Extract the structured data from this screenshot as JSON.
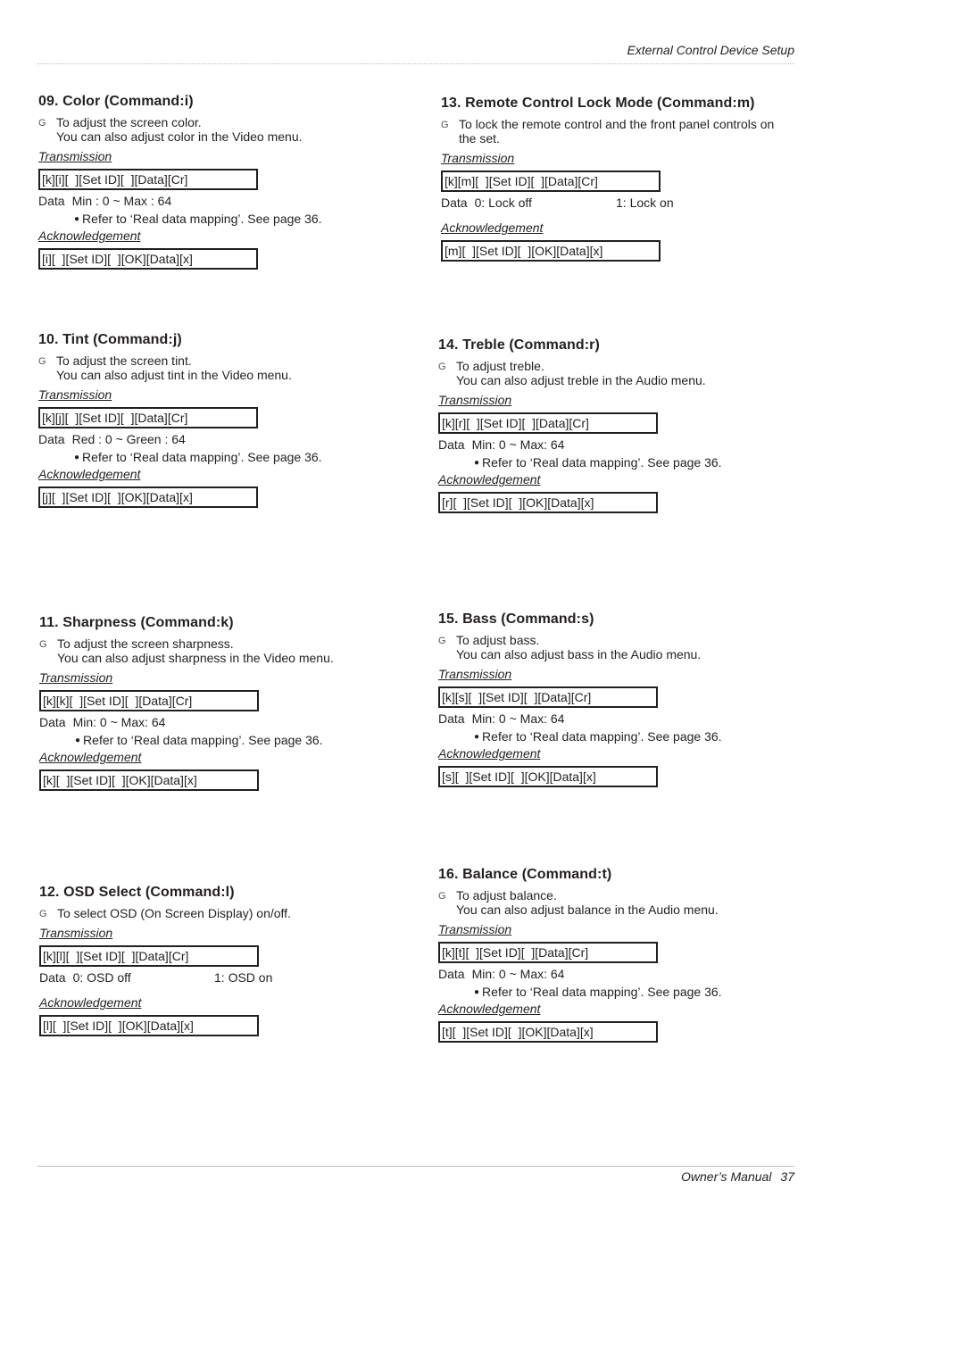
{
  "header": {
    "title": "External Control Device Setup"
  },
  "footer": {
    "label": "Owner’s Manual",
    "page": "37"
  },
  "bullet_marker": "G",
  "note_marker": "●",
  "sections": [
    {
      "title": "09. Color (Command:i)",
      "desc": [
        "To adjust the screen color.",
        "You can also adjust color in the Video menu."
      ],
      "transmission_label": "Transmission",
      "transmission": "[k][i][  ][Set ID][  ][Data][Cr]",
      "data_label": "Data",
      "data_values": [
        "Min : 0 ~ Max : 64"
      ],
      "note": "Refer to ‘Real data mapping’. See page 36.",
      "ack_label": "Acknowledgement",
      "ack": "[i][  ][Set ID][  ][OK][Data][x]"
    },
    {
      "title": "10. Tint (Command:j)",
      "desc": [
        "To adjust the screen tint.",
        "You can also adjust tint in the Video menu."
      ],
      "transmission_label": "Transmission",
      "transmission": "[k][j][  ][Set ID][  ][Data][Cr]",
      "data_label": "Data",
      "data_values": [
        "Red : 0 ~ Green : 64"
      ],
      "note": "Refer to ‘Real data mapping’. See page 36.",
      "ack_label": "Acknowledgement",
      "ack": "[j][  ][Set ID][  ][OK][Data][x]"
    },
    {
      "title": "11. Sharpness (Command:k)",
      "desc": [
        "To adjust the screen sharpness.",
        "You can also adjust sharpness in the Video menu."
      ],
      "transmission_label": "Transmission",
      "transmission": "[k][k][  ][Set ID][  ][Data][Cr]",
      "data_label": "Data",
      "data_values": [
        "Min: 0 ~ Max: 64"
      ],
      "note": "Refer to ‘Real data mapping’. See page 36.",
      "ack_label": "Acknowledgement",
      "ack": "[k][  ][Set ID][  ][OK][Data][x]"
    },
    {
      "title": "12. OSD Select (Command:l)",
      "desc": [
        "To select OSD (On Screen Display) on/off."
      ],
      "transmission_label": "Transmission",
      "transmission": "[k][l][  ][Set ID][  ][Data][Cr]",
      "data_label": "Data",
      "data_values": [
        "0: OSD off",
        "1: OSD on"
      ],
      "ack_label": "Acknowledgement",
      "ack": "[l][  ][Set ID][  ][OK][Data][x]"
    },
    {
      "title": "13. Remote Control Lock Mode (Command:m)",
      "desc": [
        "To lock the remote control and the front panel controls on",
        "the set."
      ],
      "transmission_label": "Transmission",
      "transmission": "[k][m][  ][Set ID][  ][Data][Cr]",
      "data_label": "Data",
      "data_values": [
        "0: Lock off",
        "1: Lock on"
      ],
      "ack_label": "Acknowledgement",
      "ack": "[m][  ][Set ID][  ][OK][Data][x]"
    },
    {
      "title": "14. Treble (Command:r)",
      "desc": [
        "To adjust treble.",
        "You can also adjust treble in the Audio menu."
      ],
      "transmission_label": "Transmission",
      "transmission": "[k][r][  ][Set ID][  ][Data][Cr]",
      "data_label": "Data",
      "data_values": [
        "Min: 0 ~ Max: 64"
      ],
      "note": "Refer to ‘Real data mapping’. See page 36.",
      "ack_label": "Acknowledgement",
      "ack": "[r][  ][Set ID][  ][OK][Data][x]"
    },
    {
      "title": "15. Bass (Command:s)",
      "desc": [
        "To adjust bass.",
        "You can also adjust bass in the Audio menu."
      ],
      "transmission_label": "Transmission",
      "transmission": "[k][s][  ][Set ID][  ][Data][Cr]",
      "data_label": "Data",
      "data_values": [
        "Min: 0 ~ Max: 64"
      ],
      "note": "Refer to ‘Real data mapping’. See page 36.",
      "ack_label": "Acknowledgement",
      "ack": "[s][  ][Set ID][  ][OK][Data][x]"
    },
    {
      "title": "16. Balance (Command:t)",
      "desc": [
        "To adjust balance.",
        "You can also adjust balance in the Audio menu."
      ],
      "transmission_label": "Transmission",
      "transmission": "[k][t][  ][Set ID][  ][Data][Cr]",
      "data_label": "Data",
      "data_values": [
        "Min: 0 ~ Max: 64"
      ],
      "note": "Refer to ‘Real data mapping’. See page 36.",
      "ack_label": "Acknowledgement",
      "ack": "[t][  ][Set ID][  ][OK][Data][x]"
    }
  ]
}
